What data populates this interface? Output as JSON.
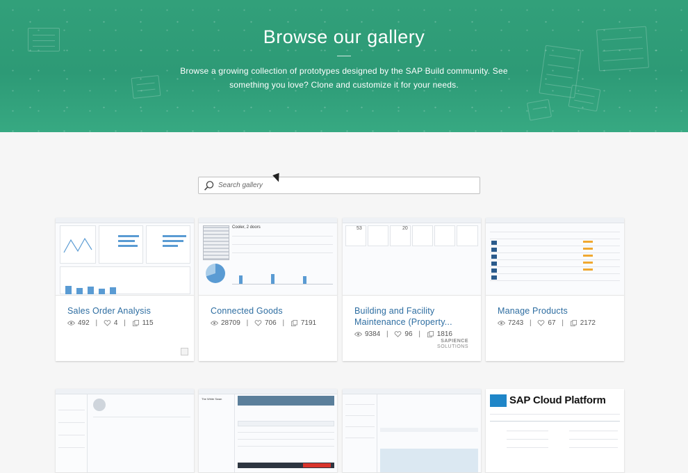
{
  "hero": {
    "title": "Browse our gallery",
    "subtitle": "Browse a growing collection of prototypes designed by the SAP Build community. See something you love? Clone and customize it for your needs."
  },
  "search": {
    "placeholder": "Search gallery"
  },
  "cards": [
    {
      "title": "Sales Order Analysis",
      "views": "492",
      "likes": "4",
      "clones": "115"
    },
    {
      "title": "Connected Goods",
      "views": "28709",
      "likes": "706",
      "clones": "7191"
    },
    {
      "title": "Building and Facility Maintenance (Property...",
      "views": "9384",
      "likes": "96",
      "clones": "1816",
      "logo_line1": "SAPIENCE",
      "logo_line2": "SOLUTIONS"
    },
    {
      "title": "Manage Products",
      "views": "7243",
      "likes": "67",
      "clones": "2172"
    }
  ],
  "row2_thumbs": [
    {
      "heading": ""
    },
    {
      "heading": "The White Swan"
    },
    {
      "heading": ""
    },
    {
      "heading": "SAP Cloud Platform"
    }
  ],
  "thumb_texts": {
    "connected_title": "Cooler, 2 doors",
    "building_count_a": "53",
    "building_count_b": "20"
  },
  "colors": {
    "hero": "#32a07a",
    "link": "#2d6da1",
    "accent": "#5a9bd3"
  },
  "icons": {
    "views": "eye-icon",
    "likes": "heart-icon",
    "clones": "clone-icon",
    "search": "search-icon"
  }
}
